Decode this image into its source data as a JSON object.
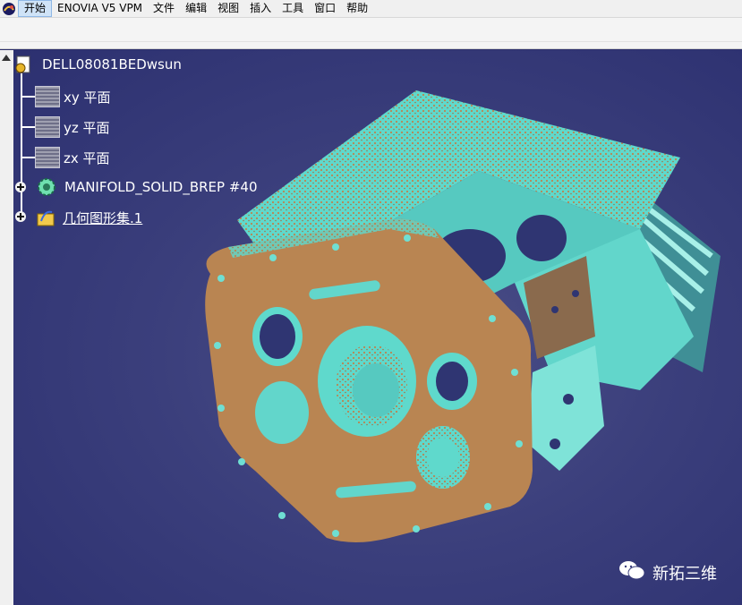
{
  "menubar": {
    "items": [
      "开始",
      "ENOVIA V5 VPM",
      "文件",
      "编辑",
      "视图",
      "插入",
      "工具",
      "窗口",
      "帮助"
    ]
  },
  "tree": {
    "root": "DELL08081BEDwsun",
    "children": [
      "xy 平面",
      "yz 平面",
      "zx 平面",
      "MANIFOLD_SOLID_BREP #40",
      "几何图形集.1"
    ]
  },
  "watermark": {
    "text": "新拓三维"
  },
  "colors": {
    "background": "#3b3f7c",
    "part_bronze": "#b98552",
    "part_cyan": "#5fd9cc"
  }
}
